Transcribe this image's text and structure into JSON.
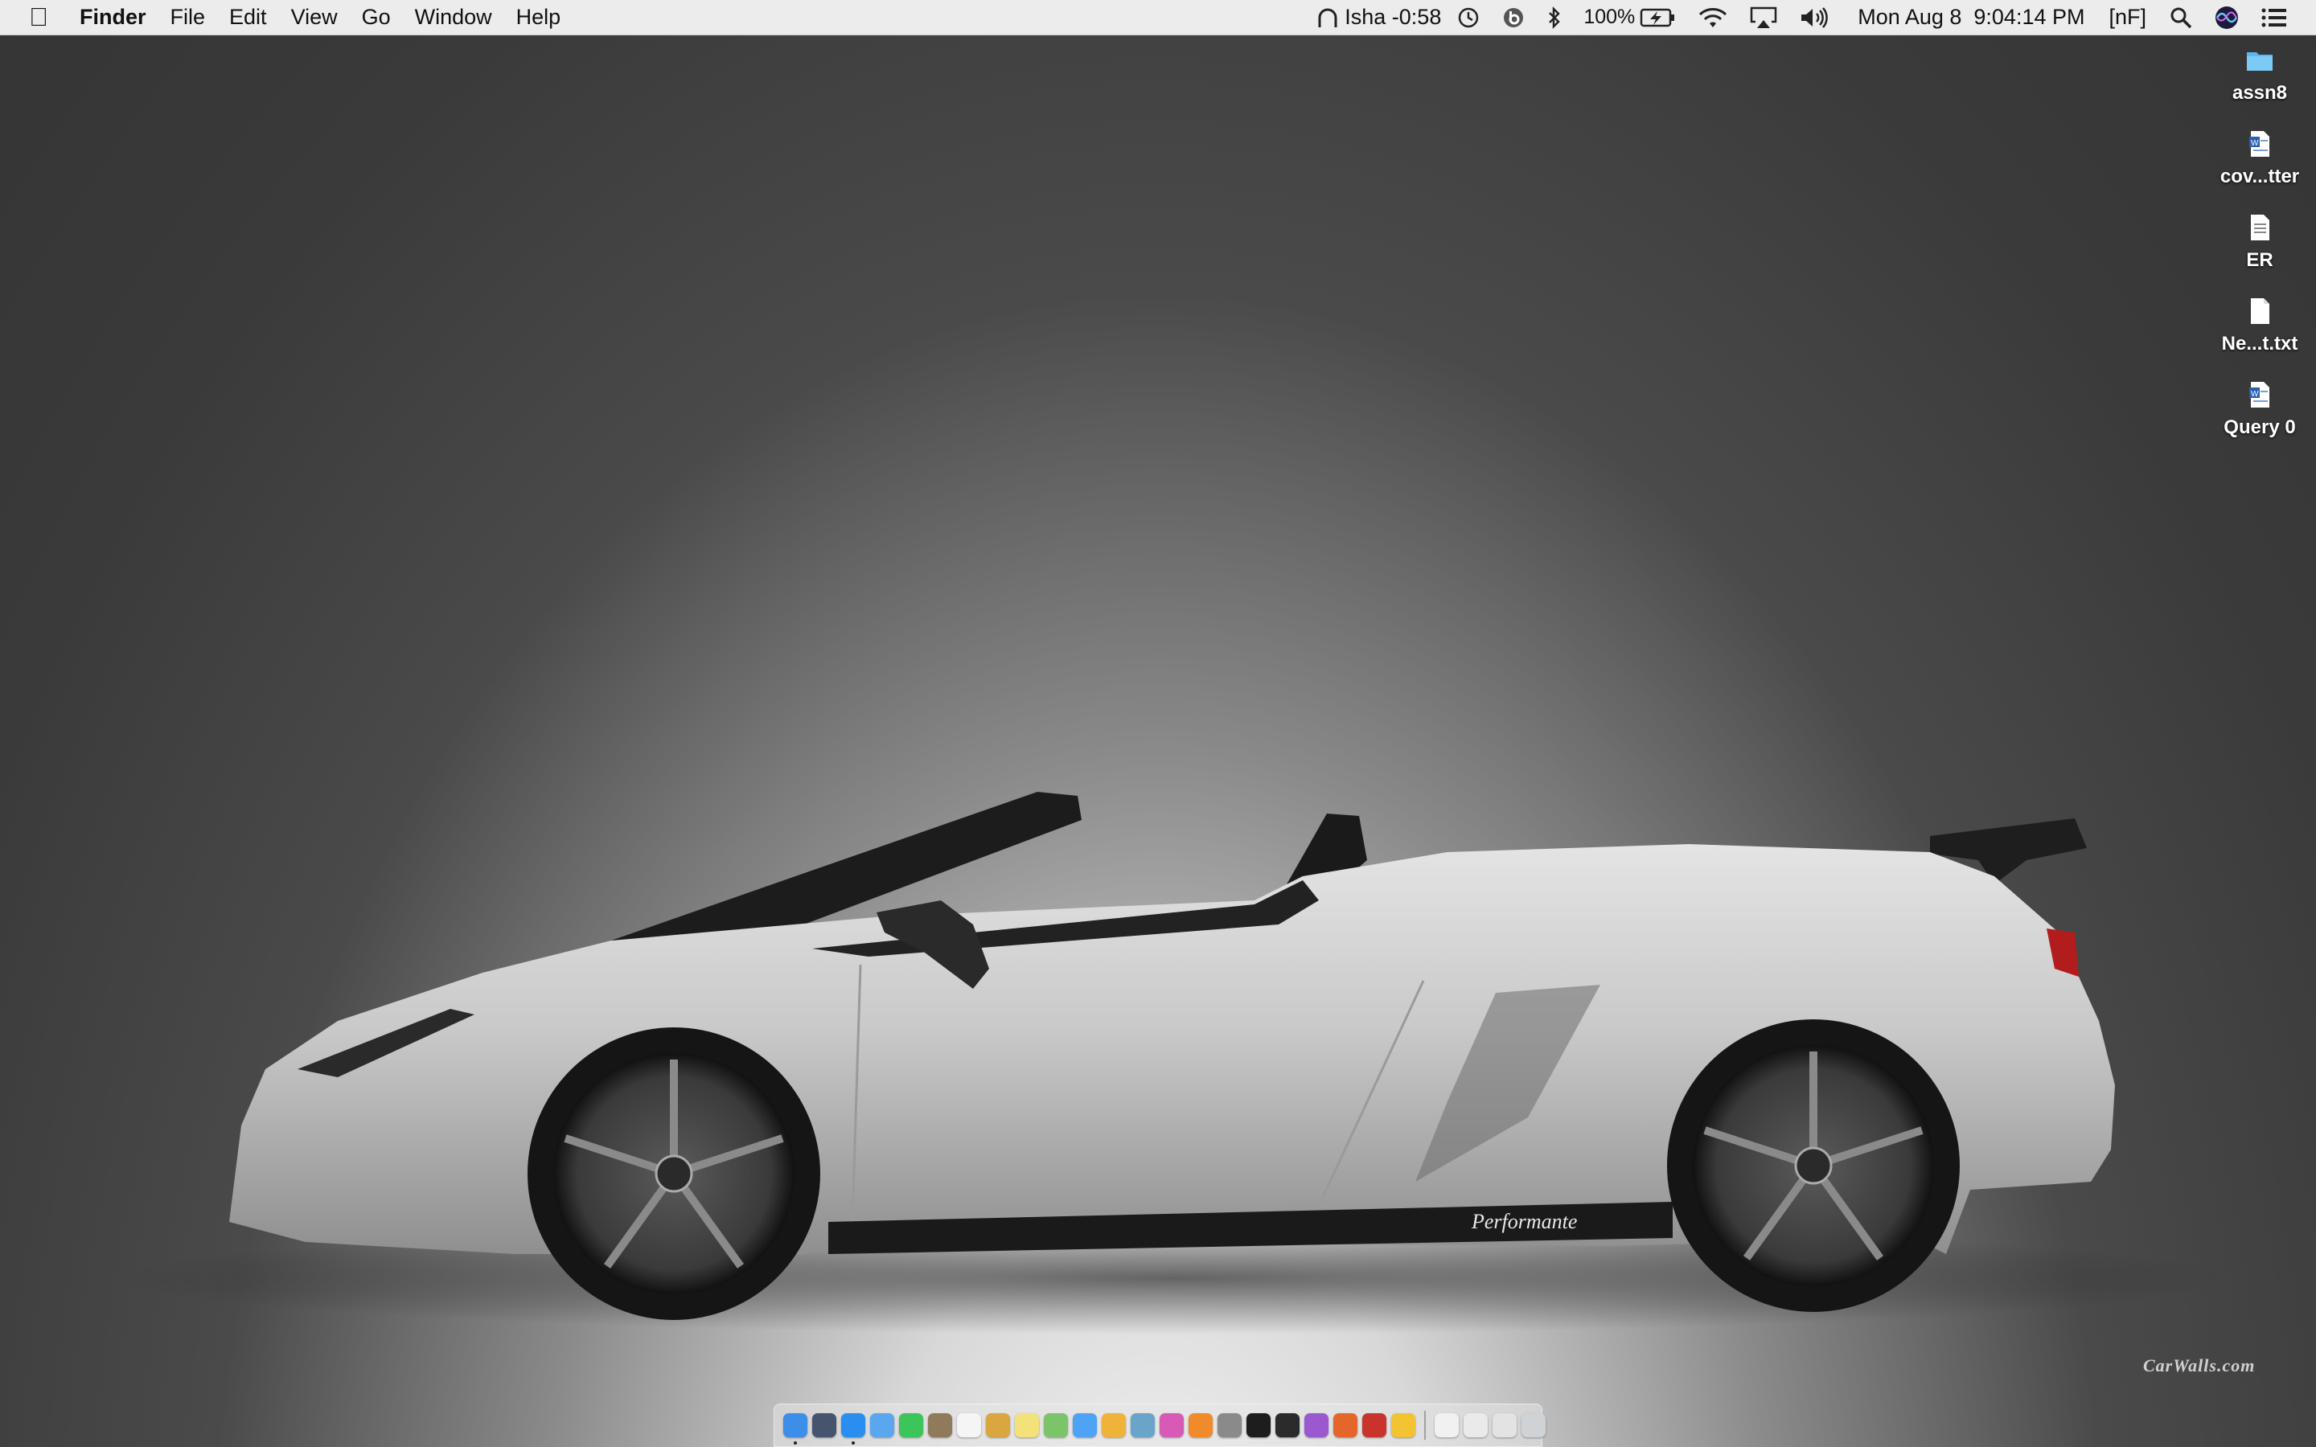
{
  "menubar": {
    "app_name": "Finder",
    "menus": [
      "File",
      "Edit",
      "View",
      "Go",
      "Window",
      "Help"
    ],
    "user_status": "Isha -0:58",
    "battery_percent": "100%",
    "datetime": "Mon Aug 8  9:04:14 PM",
    "input_indicator": "[nF]",
    "icons": [
      "apple-icon",
      "headphones-icon",
      "time-machine-icon",
      "beats-icon",
      "bluetooth-icon",
      "battery-charging-icon",
      "wifi-icon",
      "airplay-icon",
      "volume-icon",
      "spotlight-icon",
      "siri-icon",
      "notification-center-icon"
    ]
  },
  "desktop": {
    "icons": [
      {
        "label": "assn8",
        "type": "folder-icon"
      },
      {
        "label": "cov...tter",
        "type": "word-doc-icon"
      },
      {
        "label": "ER",
        "type": "document-icon"
      },
      {
        "label": "Ne...t.txt",
        "type": "text-file-icon"
      },
      {
        "label": "Query 0",
        "type": "word-doc-icon"
      }
    ],
    "watermark": "CarWalls.com",
    "car_badge": "Performante"
  },
  "dock": {
    "apps": [
      {
        "name": "finder-icon",
        "color": "#3d8ee8",
        "running": true
      },
      {
        "name": "launchpad-icon",
        "color": "#46546e",
        "running": false
      },
      {
        "name": "safari-icon",
        "color": "#2a8ef0",
        "running": true
      },
      {
        "name": "mail-icon",
        "color": "#5aa7ef",
        "running": false
      },
      {
        "name": "facetime-icon",
        "color": "#3cc55a",
        "running": false
      },
      {
        "name": "contacts-icon",
        "color": "#8f7a5c",
        "running": false
      },
      {
        "name": "calendar-icon",
        "color": "#f5f5f5",
        "running": false
      },
      {
        "name": "notes-icon",
        "color": "#d9a640",
        "running": false
      },
      {
        "name": "stickies-icon",
        "color": "#f3e27a",
        "running": false
      },
      {
        "name": "maps-icon",
        "color": "#7cc46a",
        "running": false
      },
      {
        "name": "messages-icon",
        "color": "#4fa3f7",
        "running": false
      },
      {
        "name": "photos-icon",
        "color": "#f0b33a",
        "running": false
      },
      {
        "name": "preview-icon",
        "color": "#6aa4c9",
        "running": false
      },
      {
        "name": "itunes-icon",
        "color": "#d65ab6",
        "running": false
      },
      {
        "name": "ibooks-icon",
        "color": "#f08a2a",
        "running": false
      },
      {
        "name": "system-preferences-icon",
        "color": "#8a8a8a",
        "running": false
      },
      {
        "name": "terminal-icon",
        "color": "#1d1d1d",
        "running": false
      },
      {
        "name": "activity-monitor-icon",
        "color": "#2b2b2b",
        "running": false
      },
      {
        "name": "podcasts-icon",
        "color": "#9b59d0",
        "running": false
      },
      {
        "name": "firefox-icon",
        "color": "#e5662a",
        "running": false
      },
      {
        "name": "photo-booth-icon",
        "color": "#c8332c",
        "running": false
      },
      {
        "name": "chrome-icon",
        "color": "#f2c432",
        "running": false
      }
    ],
    "stacks": [
      {
        "name": "documents-stack-icon",
        "color": "#f1f1f1"
      },
      {
        "name": "downloads-stack-icon",
        "color": "#eaeaea"
      },
      {
        "name": "folder-stack-icon",
        "color": "#e3e3e3"
      },
      {
        "name": "trash-icon",
        "color": "#cfd3d6"
      }
    ]
  }
}
